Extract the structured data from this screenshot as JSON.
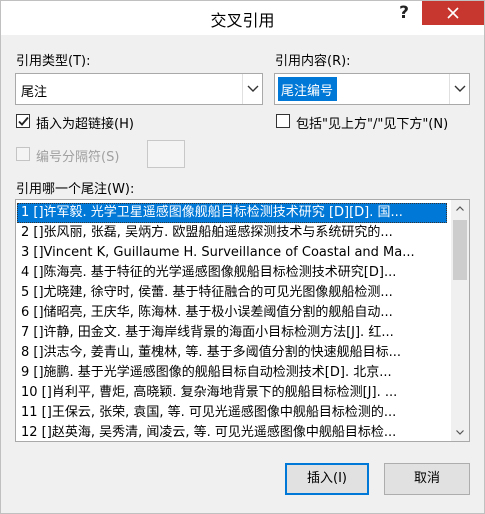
{
  "window": {
    "title": "交叉引用",
    "help": "?",
    "close": "✕"
  },
  "ref_type": {
    "label": "引用类型(T):",
    "value": "尾注"
  },
  "ref_content": {
    "label": "引用内容(R):",
    "value": "尾注编号"
  },
  "insert_hyperlink": {
    "label": "插入为超链接(H)",
    "checked": true
  },
  "include_above_below": {
    "label": "包括\"见上方\"/\"见下方\"(N)",
    "checked": false
  },
  "separator": {
    "label": "编号分隔符(S)",
    "enabled": false
  },
  "list": {
    "label": "引用哪一个尾注(W):",
    "items": [
      "1  []许军毅. 光学卫星遥感图像舰船目标检测技术研究 [D][D]. 国...",
      "2  []张风丽, 张磊, 吴炳方. 欧盟船舶遥感探测技术与系统研究的...",
      "3  []Vincent K, Guillaume H. Surveillance of Coastal and Ma...",
      "4  []陈海亮. 基于特征的光学遥感图像舰船目标检测技术研究[D]...",
      "5  []尤晓建, 徐守时, 侯蕾. 基于特征融合的可见光图像舰船检测...",
      "6  []储昭亮, 王庆华, 陈海林. 基于极小误差阈值分割的舰船自动...",
      "7  []许静, 田金文. 基于海岸线背景的海面小目标检测方法[J]. 红...",
      "8  []洪志今, 姜青山, 董槐林, 等. 基于多阈值分割的快速舰船目标...",
      "9  []施鹏. 基于光学遥感图像的舰船目标自动检测技术[D]. 北京...",
      "10  []肖利平, 曹炬, 高晓颖. 复杂海地背景下的舰船目标检测[J]. ...",
      "11  []王保云, 张荣, 袁国, 等. 可见光遥感图像中舰船目标检测的...",
      "12  []赵英海, 吴秀清, 闻凌云, 等. 可见光遥感图像中舰船目标检..."
    ],
    "selected_index": 0
  },
  "buttons": {
    "insert": "插入(I)",
    "cancel": "取消"
  }
}
